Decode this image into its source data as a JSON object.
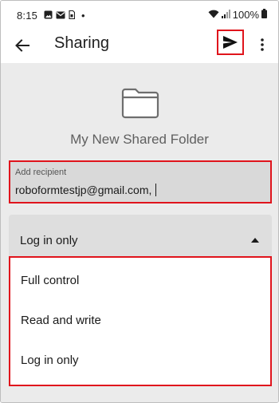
{
  "status_bar": {
    "time": "8:15",
    "dot": "•",
    "battery_percent": "100%",
    "icons": [
      "image-icon",
      "mail-icon",
      "sim-icon",
      "wifi-icon",
      "signal-icon",
      "battery-icon"
    ]
  },
  "app_bar": {
    "title": "Sharing",
    "icons": [
      "back-arrow-icon",
      "send-icon",
      "more-vert-icon"
    ]
  },
  "folder": {
    "name": "My New Shared Folder",
    "icon": "folder-icon"
  },
  "recipient": {
    "label": "Add recipient",
    "value": "roboformtestjp@gmail.com,"
  },
  "permission": {
    "selected": "Log in only",
    "options": [
      "Full control",
      "Read and write",
      "Log in only"
    ]
  },
  "colors": {
    "highlight": "#e0141c",
    "background": "#ebebeb",
    "field": "#d9d9d9"
  }
}
